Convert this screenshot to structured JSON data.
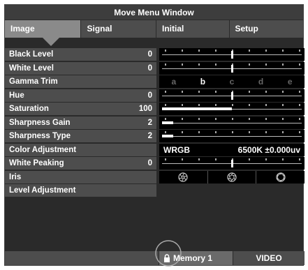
{
  "window": {
    "title": "Move Menu Window"
  },
  "tabs": [
    {
      "label": "Image",
      "active": true
    },
    {
      "label": "Signal",
      "active": false
    },
    {
      "label": "Initial",
      "active": false
    },
    {
      "label": "Setup",
      "active": false
    }
  ],
  "rows": [
    {
      "label": "Black Level",
      "value": "0",
      "control": "slider",
      "level": 0.5
    },
    {
      "label": "White Level",
      "value": "0",
      "control": "slider",
      "level": 0.5
    },
    {
      "label": "Gamma Trim",
      "value": "",
      "control": "gamma"
    },
    {
      "label": "Hue",
      "value": "0",
      "control": "slider",
      "level": 0.5
    },
    {
      "label": "Saturation",
      "value": "100",
      "control": "fill",
      "level": 0.5
    },
    {
      "label": "Sharpness Gain",
      "value": "2",
      "control": "fill",
      "level": 0.08
    },
    {
      "label": "Sharpness Type",
      "value": "2",
      "control": "fill",
      "level": 0.08
    },
    {
      "label": "Color Adjustment",
      "value": "",
      "control": "color"
    },
    {
      "label": "White Peaking",
      "value": "0",
      "control": "slider",
      "level": 0.5
    },
    {
      "label": "Iris",
      "value": "",
      "control": "iris"
    },
    {
      "label": "Level Adjustment",
      "value": "",
      "control": "none"
    }
  ],
  "gamma": {
    "options": [
      "a",
      "b",
      "c",
      "d",
      "e"
    ],
    "selected": "b"
  },
  "color_adjustment": {
    "mode": "WRGB",
    "temp": "6500K ±0.000uv"
  },
  "iris": {
    "icons": [
      "iris-small-icon",
      "iris-medium-icon",
      "iris-large-icon"
    ]
  },
  "footer": {
    "memory": "Memory 1",
    "source": "VIDEO",
    "lock_icon": "lock-icon"
  },
  "colors": {
    "window_bg": "#2a2a2a",
    "label_bg": "#4d4d4d",
    "active_tab": "#8a8a8a",
    "control_bg": "#000000"
  }
}
